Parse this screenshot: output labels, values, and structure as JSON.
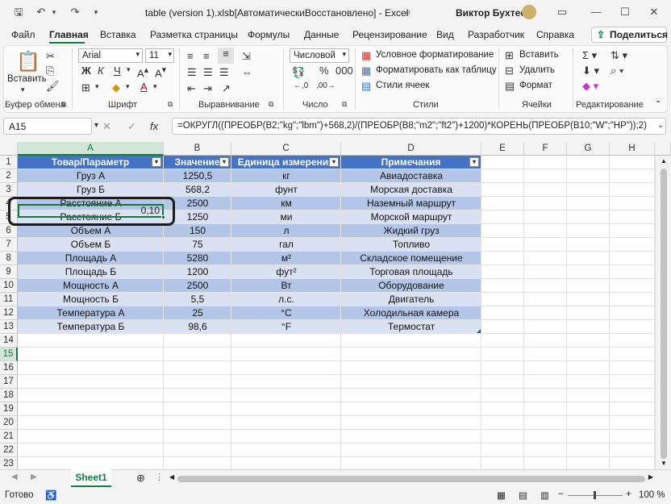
{
  "titlebar": {
    "autosave_icon": "save-icon",
    "undo_icon": "undo-icon",
    "redo_icon": "redo-icon",
    "title": "table (version 1).xlsb[АвтоматическиВосстановлено]  -  Excel",
    "search_icon": "search-icon",
    "user_name": "Виктор Бухтеев",
    "min": "—",
    "max": "☐",
    "close": "✕"
  },
  "tabs": [
    "Файл",
    "Главная",
    "Вставка",
    "Разметка страницы",
    "Формулы",
    "Данные",
    "Рецензирование",
    "Вид",
    "Разработчик",
    "Справка"
  ],
  "share_label": "Поделиться",
  "ribbon": {
    "paste_label": "Вставить",
    "groups": [
      "Буфер обмена",
      "Шрифт",
      "Выравнивание",
      "Число",
      "Стили",
      "Ячейки",
      "Редактирование"
    ],
    "font_name": "Arial",
    "font_size": "11",
    "number_format": "Числовой",
    "bold": "Ж",
    "italic": "К",
    "underline": "Ч",
    "styles": [
      "Условное форматирование",
      "Форматировать как таблицу",
      "Стили ячеек"
    ],
    "cells": [
      "Вставить",
      "Удалить",
      "Формат"
    ]
  },
  "formula_bar": {
    "name_box": "A15",
    "fx": "fx",
    "formula": "=ОКРУГЛ((ПРЕОБР(B2;\"kg\";\"lbm\")+568,2)/(ПРЕОБР(B8;\"m2\";\"ft2\")+1200)*КОРЕНЬ(ПРЕОБР(B10;\"W\";\"HP\"));2)"
  },
  "columns": [
    "A",
    "B",
    "C",
    "D",
    "E",
    "F",
    "G",
    "H"
  ],
  "rows": [
    "1",
    "2",
    "3",
    "4",
    "5",
    "6",
    "7",
    "8",
    "9",
    "10",
    "11",
    "12",
    "13",
    "14",
    "15",
    "16",
    "17",
    "18",
    "19",
    "20",
    "21",
    "22",
    "23"
  ],
  "table": {
    "headers": [
      "Товар/Параметр",
      "Значение",
      "Единица измерения",
      "Примечания"
    ],
    "rows": [
      [
        "Груз А",
        "1250,5",
        "кг",
        "Авиадоставка"
      ],
      [
        "Груз Б",
        "568,2",
        "фунт",
        "Морская доставка"
      ],
      [
        "Расстояние А",
        "2500",
        "км",
        "Наземный маршрут"
      ],
      [
        "Расстояние Б",
        "1250",
        "ми",
        "Морской маршрут"
      ],
      [
        "Объем А",
        "150",
        "л",
        "Жидкий груз"
      ],
      [
        "Объем Б",
        "75",
        "гал",
        "Топливо"
      ],
      [
        "Площадь А",
        "5280",
        "м²",
        "Складское помещение"
      ],
      [
        "Площадь Б",
        "1200",
        "фут²",
        "Торговая площадь"
      ],
      [
        "Мощность А",
        "2500",
        "Вт",
        "Оборудование"
      ],
      [
        "Мощность Б",
        "5,5",
        "л.с.",
        "Двигатель"
      ],
      [
        "Температура А",
        "25",
        "°C",
        "Холодильная камера"
      ],
      [
        "Температура Б",
        "98,6",
        "°F",
        "Термостат"
      ]
    ]
  },
  "result_cell": "0,10",
  "sheet_tab": "Sheet1",
  "status": {
    "ready": "Готово",
    "zoom": "100 %"
  }
}
